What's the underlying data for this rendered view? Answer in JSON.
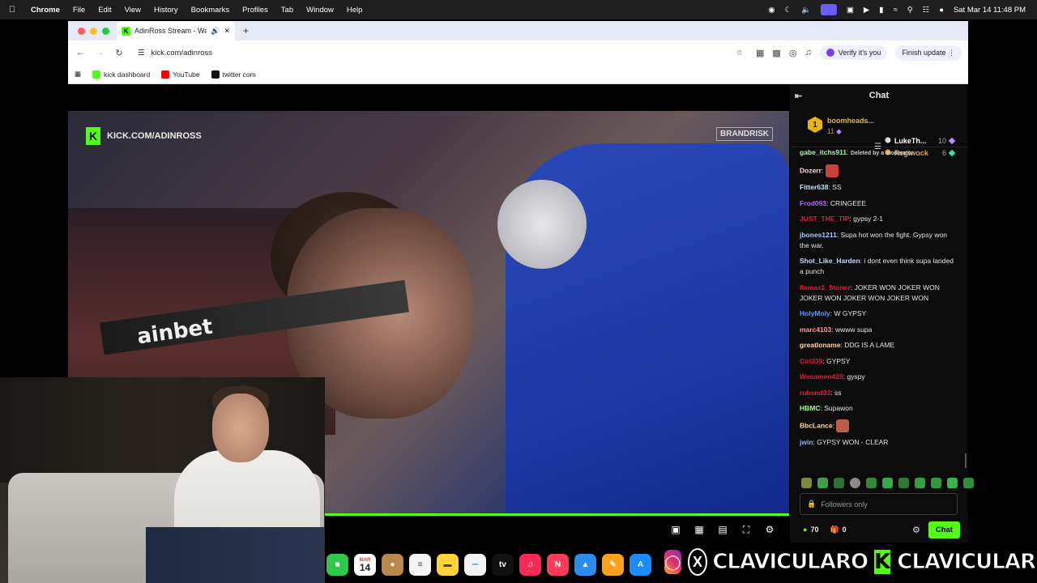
{
  "menubar": {
    "app": "Chrome",
    "items": [
      "File",
      "Edit",
      "View",
      "History",
      "Bookmarks",
      "Profiles",
      "Tab",
      "Window",
      "Help"
    ],
    "datetime": "Sat Mar 14  11:48 PM"
  },
  "browser": {
    "tab_title": "AdinRoss Stream - Watch",
    "url": "kick.com/adinross",
    "verify_label": "Verify it's you",
    "finish_update_label": "Finish update",
    "bookmarks": [
      {
        "label": "kick dashboard",
        "color": "#53fc18"
      },
      {
        "label": "YouTube",
        "color": "#ff0000"
      },
      {
        "label": "twitter com",
        "color": "#111111"
      }
    ]
  },
  "video": {
    "watermark": "KICK.COM/ADINROSS",
    "brand": "BRANDRISK",
    "ring_text": "ainbet",
    "progress": 1.0
  },
  "chat": {
    "title": "Chat",
    "leaderboard": {
      "first": {
        "name": "boomheads...",
        "count": "11"
      },
      "others": [
        {
          "name": "LukeTh...",
          "count": "10",
          "name_color": "#ffffff",
          "gem_color": "#b58cff"
        },
        {
          "name": "Regiwock",
          "count": "6",
          "name_color": "#f0a030",
          "gem_color": "#2ee6a0"
        }
      ]
    },
    "messages": [
      {
        "user": "gabe_itchs911",
        "color": "#a8f0a8",
        "text": "",
        "mod": "Deleted by a moderator"
      },
      {
        "user": "Dozerr",
        "color": "#ffd6d6",
        "text": "",
        "emote": "#c84040"
      },
      {
        "user": "Fitter638",
        "color": "#bfe6ff",
        "text": "SS"
      },
      {
        "user": "Frod093",
        "color": "#b36bff",
        "text": "CRINGEEE"
      },
      {
        "user": "JUST_THE_TIP",
        "color": "#e0203a",
        "text": "gypsy 2-1"
      },
      {
        "user": "jbones1211",
        "color": "#a8c8ff",
        "text": "Supa hot won the fight. Gypsy won the war."
      },
      {
        "user": "Shot_Like_Harden",
        "color": "#c8d8ff",
        "text": "i dont even think supa landed a punch"
      },
      {
        "user": "llamas1_Stoner",
        "color": "#e0203a",
        "text": "JOKER WON  JOKER WON  JOKER WON  JOKER WON  JOKER WON"
      },
      {
        "user": "HolyMoly",
        "color": "#5a9cff",
        "text": "W GYPSY"
      },
      {
        "user": "marc4103",
        "color": "#ff9aa8",
        "text": "wwww supa"
      },
      {
        "user": "greatloname",
        "color": "#ffd6b0",
        "text": "DDG IS A LAME"
      },
      {
        "user": "Cirl339",
        "color": "#e0203a",
        "text": "GYPSY"
      },
      {
        "user": "Wesamen420",
        "color": "#e0203a",
        "text": "gyspy"
      },
      {
        "user": "rubend33",
        "color": "#e0203a",
        "text": "ss"
      },
      {
        "user": "HBMC",
        "color": "#9cff9c",
        "text": "Supawon"
      },
      {
        "user": "BbcLance",
        "color": "#ffd6a0",
        "text": "",
        "emote": "#c05a4a"
      },
      {
        "user": "jwin",
        "color": "#8ab4ff",
        "text": "GYPSY WON - CLEAR"
      }
    ],
    "input_placeholder": "Followers only",
    "points": "70",
    "gifts": "0",
    "send_label": "Chat"
  },
  "dock": {
    "calendar_month": "MAR",
    "calendar_day": "14"
  },
  "socials": {
    "name_x": "CLAVICULARO",
    "name_kick": "CLAVICULAR"
  }
}
